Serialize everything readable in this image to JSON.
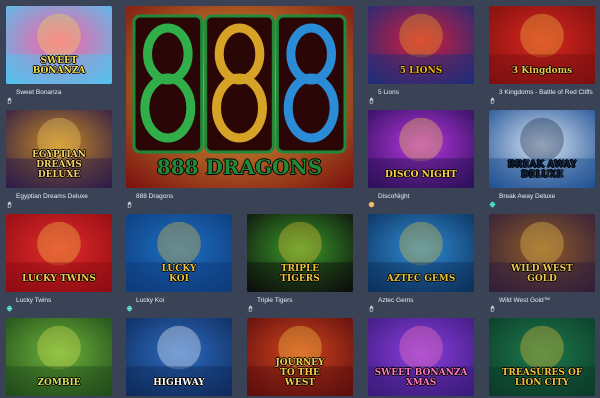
{
  "games": [
    {
      "key": "sweet-bonanza",
      "title": "Sweet Bonanza",
      "logo": "SWEET\nBONANZA",
      "icon": "hand-icon",
      "colors": [
        "#4fc3f0",
        "#ff5fa2",
        "#f7e04a"
      ]
    },
    {
      "key": "888-dragons",
      "title": "888 Dragons",
      "logo": "888 DRAGONS",
      "icon": "hand-icon",
      "colors": [
        "#7a0e0e",
        "#e4b43a",
        "#1f8a3a"
      ]
    },
    {
      "key": "5-lions",
      "title": "5 Lions",
      "logo": "5 LIONS",
      "icon": "hand-icon",
      "colors": [
        "#1b2d7a",
        "#d21b3c",
        "#f3b31a"
      ]
    },
    {
      "key": "3-kingdoms",
      "title": "3 Kingdoms - Battle of Red Cliffs",
      "logo": "3 Kingdoms",
      "icon": "hand-icon",
      "colors": [
        "#7b1010",
        "#d9251d",
        "#f1c744"
      ]
    },
    {
      "key": "egyptian-dreams-deluxe",
      "title": "Egyptian Dreams Deluxe",
      "logo": "EGYPTIAN DREAMS\nDELUXE",
      "icon": "hand-icon",
      "colors": [
        "#2a1a4a",
        "#c98a23",
        "#f5d06a"
      ]
    },
    {
      "key": "disconight",
      "title": "DiscoNight",
      "logo": "DISCO NIGHT",
      "icon": "coin-icon",
      "colors": [
        "#2a0f57",
        "#b736e0",
        "#ffd34a"
      ]
    },
    {
      "key": "break-away-deluxe",
      "title": "Break Away Deluxe",
      "logo": "BREAK AWAY\nDELUXE",
      "icon": "globe-icon",
      "colors": [
        "#1d4f93",
        "#d9e6f5",
        "#10233f"
      ]
    },
    {
      "key": "lucky-twins",
      "title": "Lucky Twins",
      "logo": "LUCKY TWINS",
      "icon": "globe-icon",
      "colors": [
        "#8e0b12",
        "#e32b2b",
        "#f5cf4a"
      ]
    },
    {
      "key": "lucky-koi",
      "title": "Lucky Koi",
      "logo": "LUCKY\nKOI",
      "icon": "globe-icon",
      "colors": [
        "#0d3a7a",
        "#1d6fc2",
        "#f0c33a"
      ]
    },
    {
      "key": "triple-tigers",
      "title": "Triple Tigers",
      "logo": "TRIPLE\nTIGERS",
      "icon": "hand-icon",
      "colors": [
        "#0c0c0c",
        "#3b9c2a",
        "#f0c33a"
      ]
    },
    {
      "key": "aztec-gems",
      "title": "Aztec Gems",
      "logo": "AZTEC GEMS",
      "icon": "hand-icon",
      "colors": [
        "#0b2f5a",
        "#2f8bd3",
        "#e8c23a"
      ]
    },
    {
      "key": "wild-west-gold",
      "title": "Wild West Gold™",
      "logo": "WILD WEST\nGOLD",
      "icon": "hand-icon",
      "colors": [
        "#2f1d3a",
        "#8f5a2a",
        "#f2c94c"
      ]
    },
    {
      "key": "zombie",
      "title": "",
      "logo": "ZOMBIE",
      "icon": "",
      "colors": [
        "#1f4a1a",
        "#6fb43a",
        "#d9e35a"
      ]
    },
    {
      "key": "highway",
      "title": "",
      "logo": "HIGHWAY",
      "icon": "",
      "colors": [
        "#0e2a5a",
        "#2d6cc2",
        "#ffffff"
      ]
    },
    {
      "key": "journey-to-the-west",
      "title": "",
      "logo": "JOURNEY\nTO THE\nWEST",
      "icon": "",
      "colors": [
        "#5a0d0d",
        "#d2441d",
        "#f5cf4a"
      ]
    },
    {
      "key": "sweet-bonanza-xmas",
      "title": "",
      "logo": "SWEET BONANZA XMAS",
      "icon": "",
      "colors": [
        "#3a1a7a",
        "#8c3ee0",
        "#ff7ab8"
      ]
    },
    {
      "key": "treasures-of-lion-city",
      "title": "",
      "logo": "TREASURES OF\nLION CITY",
      "icon": "",
      "colors": [
        "#0b3a2a",
        "#1d7a4a",
        "#f0c33a"
      ]
    }
  ]
}
